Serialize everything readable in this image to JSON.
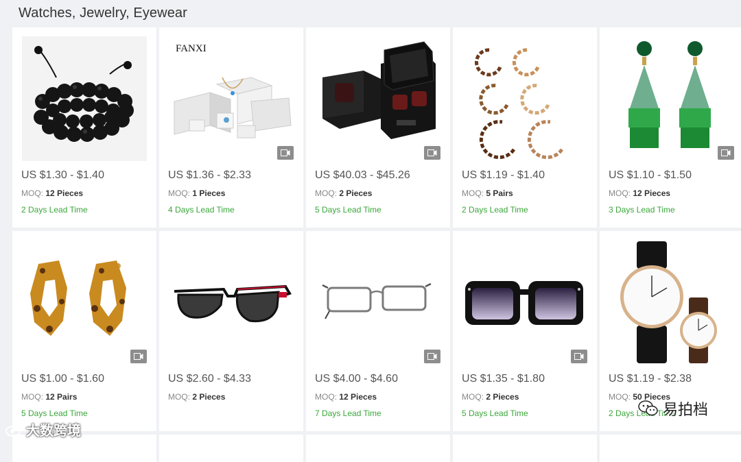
{
  "section": {
    "title": "Watches, Jewelry, Eyewear"
  },
  "moq_label": "MOQ:",
  "products": [
    {
      "image": "black-bead-bracelet",
      "price": "US $1.30 - $1.40",
      "moq": "12 Pieces",
      "lead": "2 Days Lead Time",
      "video": false
    },
    {
      "image": "fanxi-jewelry-boxes",
      "brand_text": "FANXI",
      "price": "US $1.36 - $2.33",
      "moq": "1 Pieces",
      "lead": "4 Days Lead Time",
      "video": true
    },
    {
      "image": "watch-winder-box",
      "price": "US $40.03 - $45.26",
      "moq": "2 Pieces",
      "lead": "5 Days Lead Time",
      "video": true
    },
    {
      "image": "tortoise-hoop-earrings",
      "price": "US $1.19 - $1.40",
      "moq": "5 Pairs",
      "lead": "2 Days Lead Time",
      "video": false
    },
    {
      "image": "green-tassel-earrings",
      "price": "US $1.10 - $1.50",
      "moq": "12 Pieces",
      "lead": "3 Days Lead Time",
      "video": true
    },
    {
      "image": "amber-geometric-earrings",
      "price": "US $1.00 - $1.60",
      "moq": "12 Pairs",
      "lead": "5 Days Lead Time",
      "video": true
    },
    {
      "image": "black-sunglasses",
      "price": "US $2.60 - $4.33",
      "moq": "2 Pieces",
      "lead": "",
      "video": false
    },
    {
      "image": "metal-eyeglass-frame",
      "price": "US $4.00 - $4.60",
      "moq": "12 Pieces",
      "lead": "7 Days Lead Time",
      "video": true
    },
    {
      "image": "square-gradient-sunglasses",
      "price": "US $1.35 - $1.80",
      "moq": "2 Pieces",
      "lead": "5 Days Lead Time",
      "video": true
    },
    {
      "image": "leather-strap-watches",
      "price": "US $1.19 - $2.38",
      "moq": "50 Pieces",
      "lead": "2 Days Lead Time",
      "video": false
    }
  ],
  "watermarks": {
    "left": "大数跨境",
    "right": "易拍档"
  },
  "colors": {
    "lead_time": "#3aa63a",
    "background": "#f0f1f4",
    "video_badge": "#8d8d8d"
  }
}
